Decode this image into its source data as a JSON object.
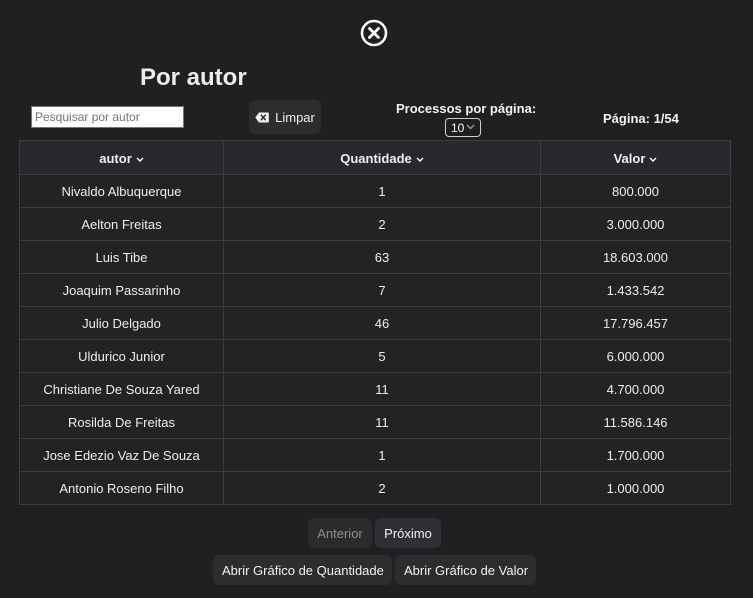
{
  "header": {
    "title": "Por autor"
  },
  "controls": {
    "search_placeholder": "Pesquisar por autor",
    "search_value": "",
    "clear_label": "Limpar",
    "per_page_label": "Processos por página:",
    "per_page_value": "10",
    "page_info": "Página: 1/54"
  },
  "table": {
    "columns": [
      "autor",
      "Quantidade",
      "Valor"
    ],
    "rows": [
      [
        "Nivaldo Albuquerque",
        "1",
        "800.000"
      ],
      [
        "Aelton Freitas",
        "2",
        "3.000.000"
      ],
      [
        "Luis Tibe",
        "63",
        "18.603.000"
      ],
      [
        "Joaquim Passarinho",
        "7",
        "1.433.542"
      ],
      [
        "Julio Delgado",
        "46",
        "17.796.457"
      ],
      [
        "Uldurico Junior",
        "5",
        "6.000.000"
      ],
      [
        "Christiane De Souza Yared",
        "11",
        "4.700.000"
      ],
      [
        "Rosilda De Freitas",
        "11",
        "11.586.146"
      ],
      [
        "Jose Edezio Vaz De Souza",
        "1",
        "1.700.000"
      ],
      [
        "Antonio Roseno Filho",
        "2",
        "1.000.000"
      ]
    ]
  },
  "pagination": {
    "prev_label": "Anterior",
    "next_label": "Próximo"
  },
  "actions": {
    "chart_quantity_label": "Abrir Gráfico de Quantidade",
    "chart_value_label": "Abrir Gráfico de Valor"
  },
  "icons": {
    "close": "close-circle-icon",
    "clear": "backspace-icon",
    "sort": "chevron-down-icon",
    "select": "chevron-down-icon"
  }
}
